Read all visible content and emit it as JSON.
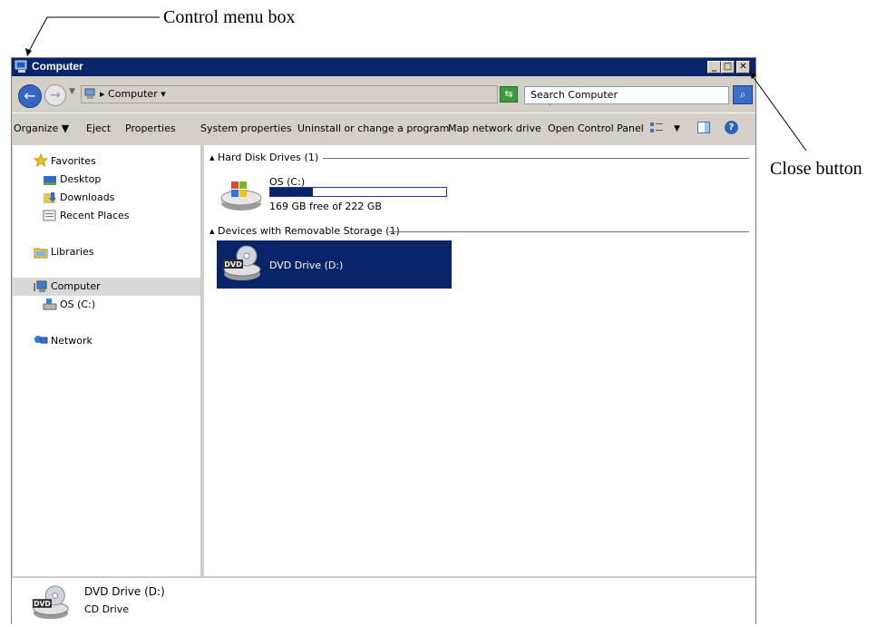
{
  "callouts": {
    "control_menu_box": "Control menu box",
    "close_button": "Close button"
  },
  "window": {
    "title": "Computer",
    "caption_buttons": {
      "minimize": "_",
      "maximize": "□",
      "close": "✕"
    }
  },
  "address": {
    "path": "Computer",
    "search_placeholder": "Search Computer"
  },
  "toolbar": {
    "organize": "Organize",
    "eject": "Eject",
    "properties": "Properties",
    "system_properties": "System properties",
    "uninstall": "Uninstall or change a program",
    "map_drive": "Map network drive",
    "control_panel": "Open Control Panel"
  },
  "nav": {
    "favorites": "Favorites",
    "desktop": "Desktop",
    "downloads": "Downloads",
    "recent": "Recent Places",
    "libraries": "Libraries",
    "computer": "Computer",
    "os_c": "OS (C:)",
    "network": "Network"
  },
  "content": {
    "hdd_group": "Hard Disk Drives (1)",
    "os_name": "OS (C:)",
    "os_free": "169 GB free of 222 GB",
    "os_used_fraction": 0.24,
    "removable_group": "Devices with Removable Storage (1)",
    "dvd_name": "DVD Drive (D:)"
  },
  "details": {
    "name": "DVD Drive (D:)",
    "type": "CD Drive"
  },
  "colors": {
    "titlebar": "#0a246a",
    "selection": "#0a246a",
    "chrome": "#d4d0c8"
  }
}
